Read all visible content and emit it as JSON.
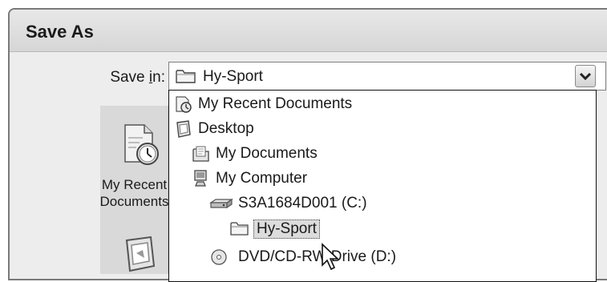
{
  "dialog": {
    "title": "Save As"
  },
  "save_in": {
    "label_before": "Save ",
    "label_accel": "i",
    "label_after": "n:",
    "selected_value": "Hy-Sport",
    "selected_icon": "folder-icon"
  },
  "places": [
    {
      "label_line1": "My Recent",
      "label_line2": "Documents",
      "icon": "recent-documents-icon"
    }
  ],
  "dropdown_items": [
    {
      "label": "My Recent Documents",
      "icon": "recent-documents-icon",
      "indent": 0
    },
    {
      "label": "Desktop",
      "icon": "desktop-icon",
      "indent": 0
    },
    {
      "label": "My Documents",
      "icon": "documents-icon",
      "indent": 1
    },
    {
      "label": "My Computer",
      "icon": "computer-icon",
      "indent": 1
    },
    {
      "label": "S3A1684D001 (C:)",
      "icon": "hard-drive-icon",
      "indent": 2
    },
    {
      "label": "Hy-Sport",
      "icon": "folder-icon",
      "indent": 3,
      "selected": true
    },
    {
      "label": "DVD/CD-RW Drive (D:)",
      "icon": "optical-drive-icon",
      "indent": 2
    }
  ],
  "colors": {
    "dialog_background": "#ededed",
    "selection_highlight": "#dcdcdc"
  }
}
